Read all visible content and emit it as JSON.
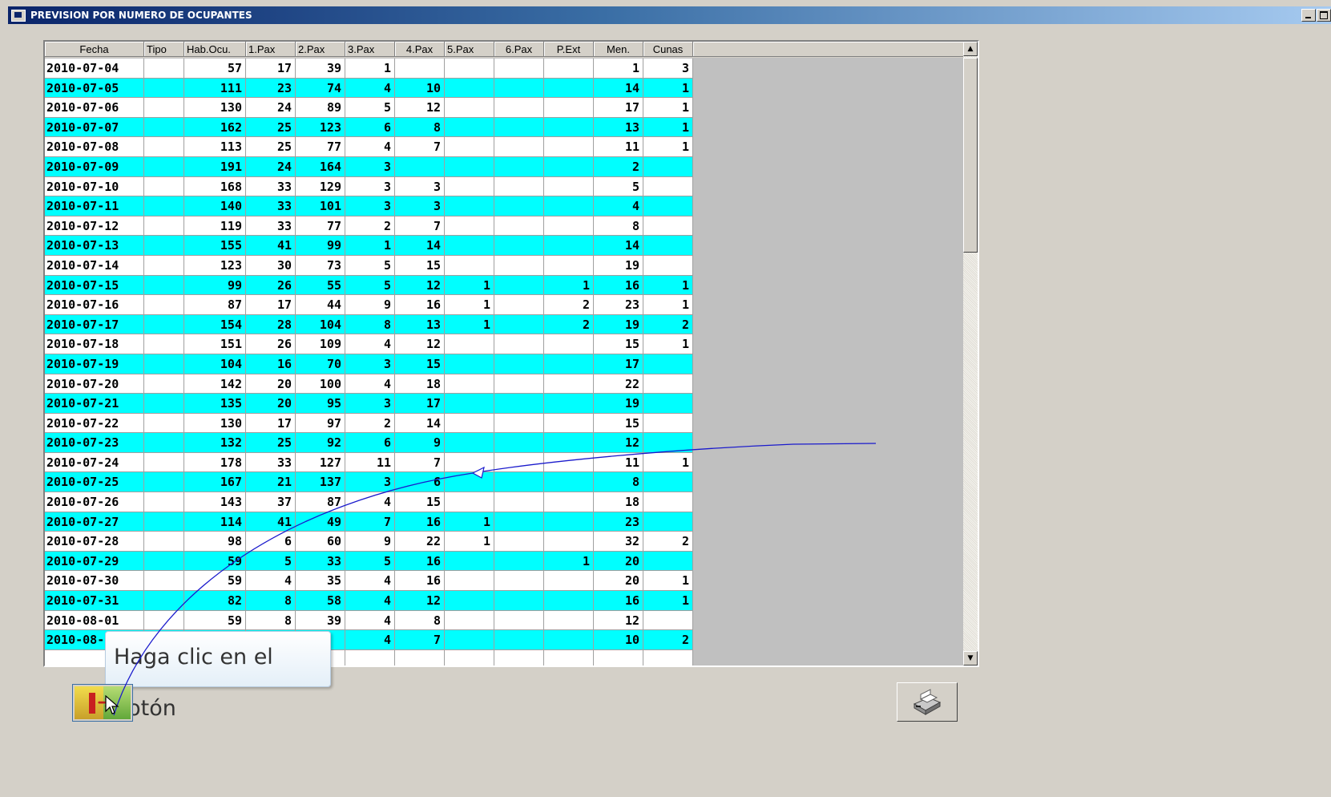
{
  "window": {
    "title": "PREVISION POR NUMERO DE OCUPANTES"
  },
  "grid": {
    "columns": [
      "Fecha",
      "Tipo",
      "Hab.Ocu.",
      "1.Pax",
      "2.Pax",
      "3.Pax",
      "4.Pax",
      "5.Pax",
      "6.Pax",
      "P.Ext",
      "Men.",
      "Cunas"
    ],
    "rows": [
      [
        "2010-07-04",
        "",
        "57",
        "17",
        "39",
        "1",
        "",
        "",
        "",
        "",
        "1",
        "3"
      ],
      [
        "2010-07-05",
        "",
        "111",
        "23",
        "74",
        "4",
        "10",
        "",
        "",
        "",
        "14",
        "1"
      ],
      [
        "2010-07-06",
        "",
        "130",
        "24",
        "89",
        "5",
        "12",
        "",
        "",
        "",
        "17",
        "1"
      ],
      [
        "2010-07-07",
        "",
        "162",
        "25",
        "123",
        "6",
        "8",
        "",
        "",
        "",
        "13",
        "1"
      ],
      [
        "2010-07-08",
        "",
        "113",
        "25",
        "77",
        "4",
        "7",
        "",
        "",
        "",
        "11",
        "1"
      ],
      [
        "2010-07-09",
        "",
        "191",
        "24",
        "164",
        "3",
        "",
        "",
        "",
        "",
        "2",
        ""
      ],
      [
        "2010-07-10",
        "",
        "168",
        "33",
        "129",
        "3",
        "3",
        "",
        "",
        "",
        "5",
        ""
      ],
      [
        "2010-07-11",
        "",
        "140",
        "33",
        "101",
        "3",
        "3",
        "",
        "",
        "",
        "4",
        ""
      ],
      [
        "2010-07-12",
        "",
        "119",
        "33",
        "77",
        "2",
        "7",
        "",
        "",
        "",
        "8",
        ""
      ],
      [
        "2010-07-13",
        "",
        "155",
        "41",
        "99",
        "1",
        "14",
        "",
        "",
        "",
        "14",
        ""
      ],
      [
        "2010-07-14",
        "",
        "123",
        "30",
        "73",
        "5",
        "15",
        "",
        "",
        "",
        "19",
        ""
      ],
      [
        "2010-07-15",
        "",
        "99",
        "26",
        "55",
        "5",
        "12",
        "1",
        "",
        "1",
        "16",
        "1"
      ],
      [
        "2010-07-16",
        "",
        "87",
        "17",
        "44",
        "9",
        "16",
        "1",
        "",
        "2",
        "23",
        "1"
      ],
      [
        "2010-07-17",
        "",
        "154",
        "28",
        "104",
        "8",
        "13",
        "1",
        "",
        "2",
        "19",
        "2"
      ],
      [
        "2010-07-18",
        "",
        "151",
        "26",
        "109",
        "4",
        "12",
        "",
        "",
        "",
        "15",
        "1"
      ],
      [
        "2010-07-19",
        "",
        "104",
        "16",
        "70",
        "3",
        "15",
        "",
        "",
        "",
        "17",
        ""
      ],
      [
        "2010-07-20",
        "",
        "142",
        "20",
        "100",
        "4",
        "18",
        "",
        "",
        "",
        "22",
        ""
      ],
      [
        "2010-07-21",
        "",
        "135",
        "20",
        "95",
        "3",
        "17",
        "",
        "",
        "",
        "19",
        ""
      ],
      [
        "2010-07-22",
        "",
        "130",
        "17",
        "97",
        "2",
        "14",
        "",
        "",
        "",
        "15",
        ""
      ],
      [
        "2010-07-23",
        "",
        "132",
        "25",
        "92",
        "6",
        "9",
        "",
        "",
        "",
        "12",
        ""
      ],
      [
        "2010-07-24",
        "",
        "178",
        "33",
        "127",
        "11",
        "7",
        "",
        "",
        "",
        "11",
        "1"
      ],
      [
        "2010-07-25",
        "",
        "167",
        "21",
        "137",
        "3",
        "6",
        "",
        "",
        "",
        "8",
        ""
      ],
      [
        "2010-07-26",
        "",
        "143",
        "37",
        "87",
        "4",
        "15",
        "",
        "",
        "",
        "18",
        ""
      ],
      [
        "2010-07-27",
        "",
        "114",
        "41",
        "49",
        "7",
        "16",
        "1",
        "",
        "",
        "23",
        ""
      ],
      [
        "2010-07-28",
        "",
        "98",
        "6",
        "60",
        "9",
        "22",
        "1",
        "",
        "",
        "32",
        "2"
      ],
      [
        "2010-07-29",
        "",
        "59",
        "5",
        "33",
        "5",
        "16",
        "",
        "",
        "1",
        "20",
        ""
      ],
      [
        "2010-07-30",
        "",
        "59",
        "4",
        "35",
        "4",
        "16",
        "",
        "",
        "",
        "20",
        "1"
      ],
      [
        "2010-07-31",
        "",
        "82",
        "8",
        "58",
        "4",
        "12",
        "",
        "",
        "",
        "16",
        "1"
      ],
      [
        "2010-08-01",
        "",
        "59",
        "8",
        "39",
        "4",
        "8",
        "",
        "",
        "",
        "12",
        ""
      ],
      [
        "2010-08-02",
        "",
        "",
        "",
        "",
        "4",
        "7",
        "",
        "",
        "",
        "10",
        "2"
      ],
      [
        "",
        "",
        "",
        "",
        "",
        "",
        "",
        "",
        "",
        "",
        "",
        ""
      ]
    ]
  },
  "tooltip": {
    "text": "Haga clic en el botón"
  },
  "buttons": {
    "exit_icon": "exit-door-icon",
    "print_icon": "printer-icon"
  },
  "colors": {
    "row_highlight": "#00ffff",
    "titlebar": "#0a246a"
  }
}
